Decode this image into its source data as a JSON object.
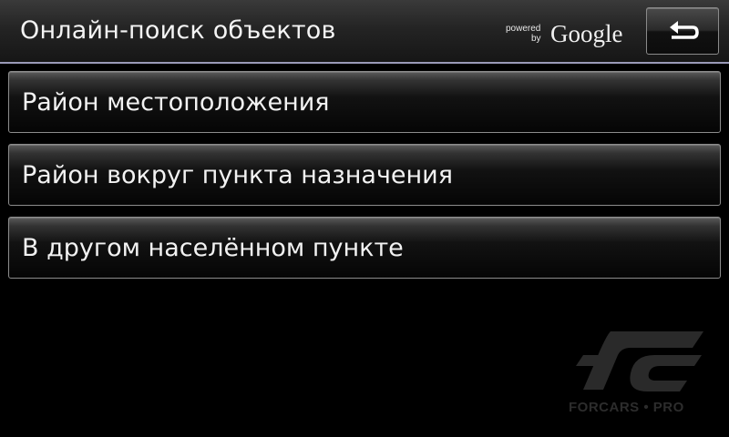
{
  "header": {
    "title": "Онлайн-поиск объектов",
    "powered_prefix": "powered",
    "powered_by": "by",
    "powered_brand": "Google",
    "back_icon": "back-arrow-icon"
  },
  "menu": {
    "items": [
      {
        "label": "Район местоположения"
      },
      {
        "label": "Район вокруг пункта назначения"
      },
      {
        "label": "В другом населённом пункте"
      }
    ]
  },
  "watermark": {
    "text": "FORCARS • PRO"
  },
  "colors": {
    "background": "#000000",
    "header_border": "#9a9ab8",
    "button_border": "#8c8c8c",
    "text": "#f2f2f2"
  }
}
